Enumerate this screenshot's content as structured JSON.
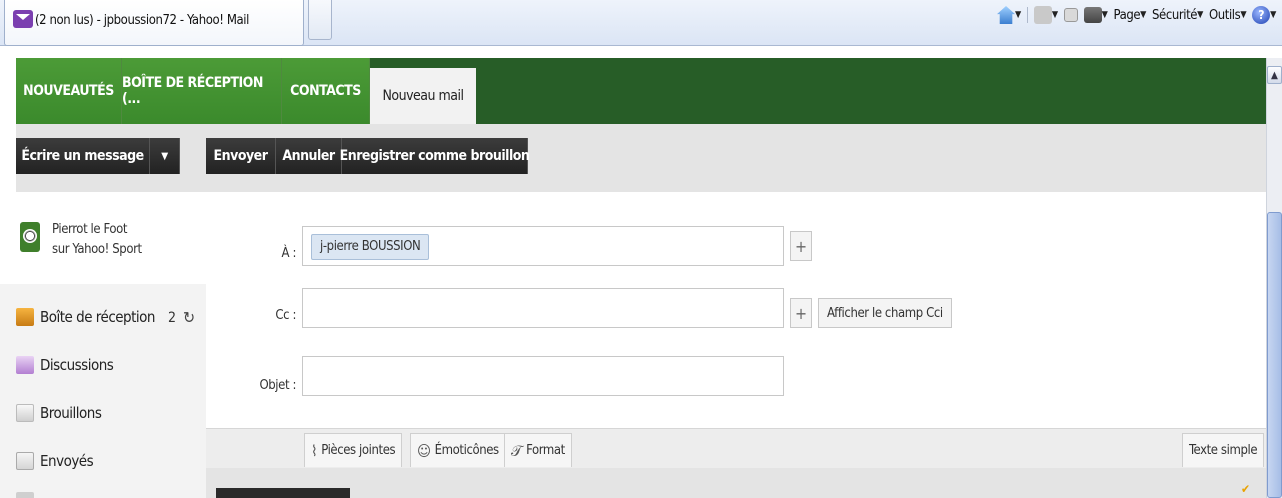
{
  "browser": {
    "tab_title": "(2 non lus) - jpboussion72 - Yahoo! Mail",
    "cmd_page": "Page",
    "cmd_security": "Sécurité",
    "cmd_tools": "Outils",
    "icons": [
      "home-icon",
      "rss-icon",
      "read-mail-icon",
      "print-icon",
      "help-icon"
    ]
  },
  "nav": {
    "tabs": [
      {
        "label": "NOUVEAUTÉS"
      },
      {
        "label": "BOÎTE DE RÉCEPTION (..."
      },
      {
        "label": "CONTACTS"
      },
      {
        "label": "Nouveau mail"
      }
    ]
  },
  "toolbar": {
    "compose_label": "Écrire un message",
    "compose_menu_caret": "▼",
    "send_label": "Envoyer",
    "cancel_label": "Annuler",
    "save_draft_label": "Enregistrer comme brouillon"
  },
  "sidebar": {
    "promo_line1": "Pierrot le Foot",
    "promo_line2": "sur Yahoo! Sport",
    "folders": [
      {
        "label": "Boîte de réception",
        "count": "2"
      },
      {
        "label": "Discussions"
      },
      {
        "label": "Brouillons"
      },
      {
        "label": "Envoyés"
      }
    ]
  },
  "compose": {
    "to_label": "À :",
    "to_recipient": "j-pierre BOUSSION",
    "cc_label": "Cc :",
    "cc_value": "",
    "subject_label": "Objet :",
    "subject_value": "",
    "add_button": "+",
    "show_bcc": "Afficher le champ Cci"
  },
  "format_bar": {
    "attachments": "Pièces jointes",
    "emoticons": "Émoticônes",
    "format": "Format",
    "plain_text": "Texte simple"
  },
  "colors": {
    "nav_bg": "#275d27",
    "nav_tab": "#3b8a2c",
    "toolbar_button": "#2b2b2b"
  }
}
